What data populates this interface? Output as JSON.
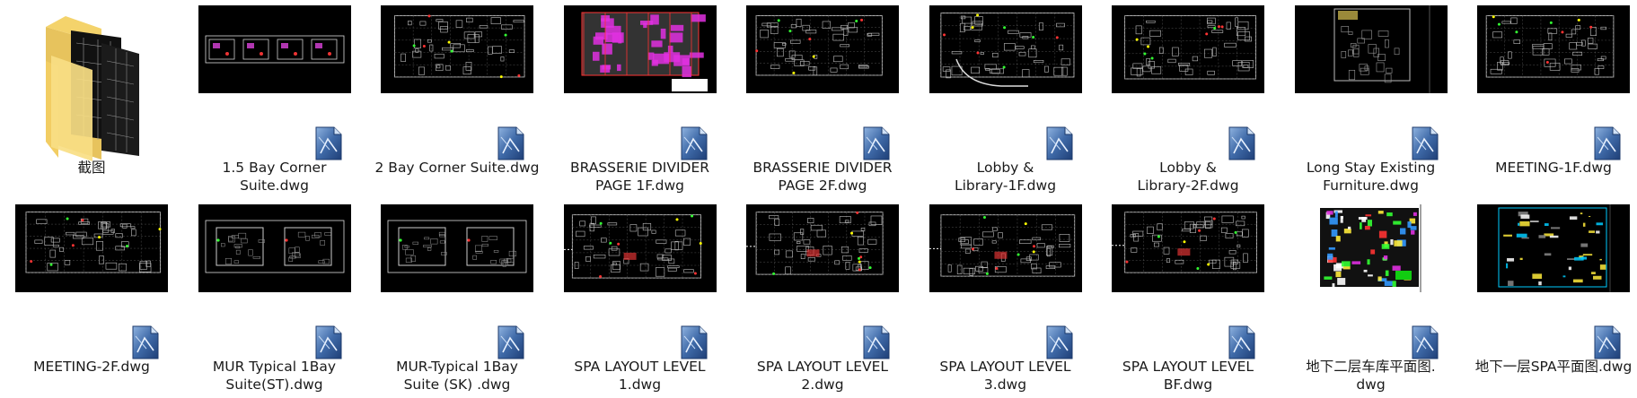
{
  "items": [
    {
      "name": "截图",
      "type": "folder"
    },
    {
      "name": "1.5 Bay Corner\nSuite.dwg",
      "type": "dwg",
      "preview": "small-rooms"
    },
    {
      "name": "2 Bay Corner Suite.dwg",
      "type": "dwg",
      "preview": "grid-plan"
    },
    {
      "name": "BRASSERIE DIVIDER\nPAGE 1F.dwg",
      "type": "dwg",
      "preview": "magenta-plan"
    },
    {
      "name": "BRASSERIE DIVIDER\nPAGE 2F.dwg",
      "type": "dwg",
      "preview": "gray-plan"
    },
    {
      "name": "Lobby &\nLibrary-1F.dwg",
      "type": "dwg",
      "preview": "lobby"
    },
    {
      "name": "Lobby &\nLibrary-2F.dwg",
      "type": "dwg",
      "preview": "lobby2"
    },
    {
      "name": "Long Stay Existing\nFurniture.dwg",
      "type": "dwg",
      "preview": "furniture"
    },
    {
      "name": "MEETING-1F.dwg",
      "type": "dwg",
      "preview": "meeting"
    },
    {
      "name": "MEETING-2F.dwg",
      "type": "dwg",
      "preview": "meeting2"
    },
    {
      "name": "MUR Typical 1Bay\nSuite(ST).dwg",
      "type": "dwg",
      "preview": "two-rooms"
    },
    {
      "name": "MUR-Typical 1Bay\nSuite (SK)  .dwg",
      "type": "dwg",
      "preview": "two-rooms2"
    },
    {
      "name": "SPA LAYOUT LEVEL\n1.dwg",
      "type": "dwg",
      "preview": "spa"
    },
    {
      "name": "SPA LAYOUT LEVEL\n2.dwg",
      "type": "dwg",
      "preview": "spa2"
    },
    {
      "name": "SPA LAYOUT LEVEL\n3.dwg",
      "type": "dwg",
      "preview": "spa3"
    },
    {
      "name": "SPA LAYOUT LEVEL\nBF.dwg",
      "type": "dwg",
      "preview": "spa4"
    },
    {
      "name": "地下二层车库平面图.\ndwg",
      "type": "dwg",
      "preview": "garage"
    },
    {
      "name": "地下一层SPA平面图.dwg",
      "type": "dwg",
      "preview": "basement"
    }
  ],
  "colors": {
    "background": "#ffffff",
    "thumb_bg": "#000000",
    "folder_yellow": "#f4d36b",
    "dwg_blue": "#3f6aa8",
    "label": "#1a1a1a"
  }
}
